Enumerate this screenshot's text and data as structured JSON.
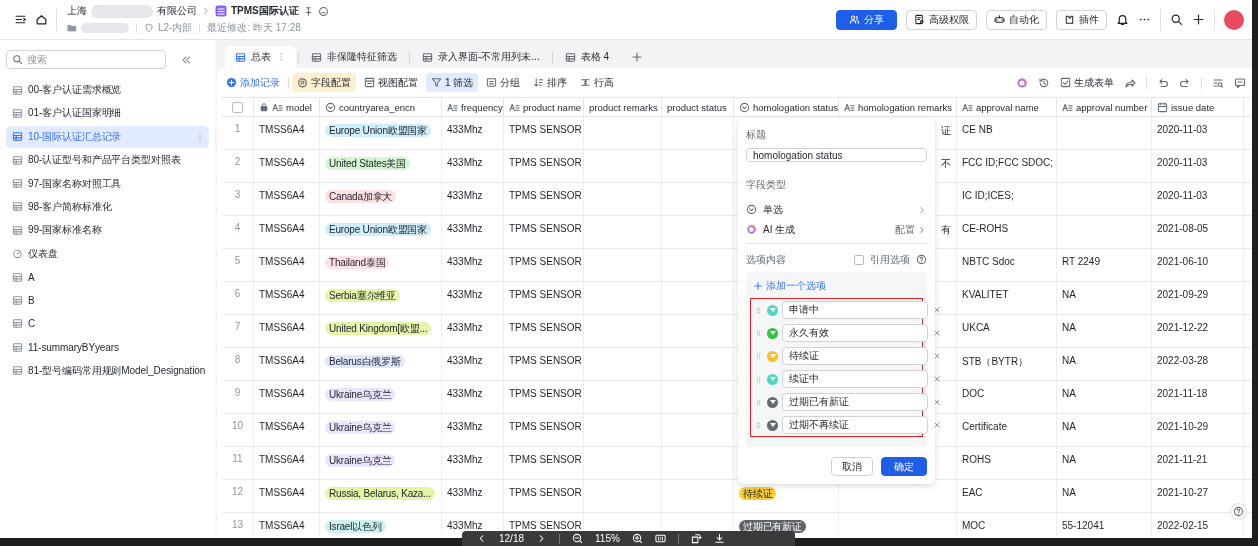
{
  "topbar": {
    "org_prefix": "上海",
    "org_suffix": "有限公司",
    "doc_title": "TPMS国际认证",
    "security": "L2-内部",
    "modified": "最近修改: 昨天 17:28",
    "buttons": [
      {
        "label": "分享",
        "kind": "share"
      },
      {
        "label": "高级权限",
        "kind": "permission"
      },
      {
        "label": "自动化",
        "kind": "automation"
      },
      {
        "label": "插件",
        "kind": "plugin"
      }
    ]
  },
  "sidebar": {
    "search_placeholder": "搜索",
    "items": [
      {
        "label": "00-客户认证需求概览",
        "kind": "table",
        "selected": false
      },
      {
        "label": "01-客户认证国家明细",
        "kind": "table",
        "selected": false
      },
      {
        "label": "10-国际认证汇总记录",
        "kind": "table",
        "selected": true
      },
      {
        "label": "80-认证型号和产品平台类型对照表",
        "kind": "table",
        "selected": false
      },
      {
        "label": "97-国家名称对照工具",
        "kind": "table",
        "selected": false
      },
      {
        "label": "98-客户简称标准化",
        "kind": "table",
        "selected": false
      },
      {
        "label": "99-国家标准名称",
        "kind": "table",
        "selected": false
      },
      {
        "label": "仪表盘",
        "kind": "dashboard",
        "selected": false
      },
      {
        "label": "A",
        "kind": "table",
        "selected": false
      },
      {
        "label": "B",
        "kind": "table",
        "selected": false
      },
      {
        "label": "C",
        "kind": "table",
        "selected": false
      },
      {
        "label": "11-summaryBYyears",
        "kind": "table",
        "selected": false
      },
      {
        "label": "81-型号编码常用规则Model_Designation",
        "kind": "table",
        "selected": false
      }
    ]
  },
  "view_tabs": [
    {
      "label": "总表",
      "selected": true
    },
    {
      "label": "非保隆特征筛选",
      "selected": false
    },
    {
      "label": "录入界面-不常用列未...",
      "selected": false
    },
    {
      "label": "表格 4",
      "selected": false
    }
  ],
  "toolbar": {
    "items": [
      {
        "label": "添加记录",
        "kind": "add",
        "active": false
      },
      {
        "label": "字段配置",
        "kind": "fields",
        "active": true
      },
      {
        "label": "视图配置",
        "kind": "view",
        "active": false
      },
      {
        "label": "1 筛选",
        "kind": "filter",
        "active": true
      },
      {
        "label": "分组",
        "kind": "group",
        "active": false
      },
      {
        "label": "排序",
        "kind": "sort",
        "active": false
      },
      {
        "label": "行高",
        "kind": "row-height",
        "active": false
      }
    ],
    "form_label": "生成表单"
  },
  "table": {
    "all_checked": false,
    "columns": [
      {
        "label": "model",
        "kind": "text",
        "locked": true
      },
      {
        "label": "countryarea_encn",
        "kind": "select",
        "locked": false
      },
      {
        "label": "frequency",
        "kind": "text",
        "locked": false
      },
      {
        "label": "product name",
        "kind": "text",
        "locked": false
      },
      {
        "label": "product remarks",
        "kind": "plain",
        "locked": false
      },
      {
        "label": "product status",
        "kind": "plain",
        "locked": false
      },
      {
        "label": "homologation status",
        "kind": "select",
        "locked": false
      },
      {
        "label": "homologation remarks",
        "kind": "text",
        "locked": false
      },
      {
        "label": "approval name",
        "kind": "text",
        "locked": false
      },
      {
        "label": "approval number",
        "kind": "text",
        "locked": false
      },
      {
        "label": "issue date",
        "kind": "date",
        "locked": false
      }
    ],
    "rows": [
      {
        "no": "1",
        "model": "TMSS6A4",
        "country": {
          "text": "Europe Union欧盟国家",
          "color": "#cdeefa"
        },
        "frequency": "433Mhz",
        "product_name": "TPMS SENSOR",
        "remarks": "证",
        "approval_name": "CE NB",
        "issue_date": "2020-11-03"
      },
      {
        "no": "2",
        "model": "TMSS6A4",
        "country": {
          "text": "United States美国",
          "color": "#d4f5d0"
        },
        "frequency": "433Mhz",
        "product_name": "TPMS SENSOR",
        "remarks": "不",
        "approval_name": "FCC ID;FCC SDOC;",
        "issue_date": "2020-11-03"
      },
      {
        "no": "3",
        "model": "TMSS6A4",
        "country": {
          "text": "Canada加拿大",
          "color": "#fde1e1"
        },
        "frequency": "433Mhz",
        "product_name": "TPMS SENSOR",
        "approval_name": "IC ID;ICES;",
        "issue_date": "2020-11-03"
      },
      {
        "no": "4",
        "model": "TMSS6A4",
        "country": {
          "text": "Europe Union欧盟国家",
          "color": "#cdeefa"
        },
        "frequency": "433Mhz",
        "product_name": "TPMS SENSOR",
        "remarks": "有",
        "approval_name": "CE-ROHS",
        "issue_date": "2021-08-05"
      },
      {
        "no": "5",
        "model": "TMSS6A4",
        "country": {
          "text": "Thailand泰国",
          "color": "#fde0ec"
        },
        "frequency": "433Mhz",
        "product_name": "TPMS SENSOR",
        "approval_name": "NBTC Sdoc",
        "approval_number": "RT 2249",
        "issue_date": "2021-06-10"
      },
      {
        "no": "6",
        "model": "TMSS6A4",
        "country": {
          "text": "Serbia塞尔维亚",
          "color": "#e4f5a9"
        },
        "frequency": "433Mhz",
        "product_name": "TPMS SENSOR",
        "approval_name": "KVALITET",
        "approval_number": "NA",
        "issue_date": "2021-09-29"
      },
      {
        "no": "7",
        "model": "TMSS6A4",
        "country": {
          "text": "United Kingdom[欧盟...",
          "color": "#e4f5a9"
        },
        "frequency": "433Mhz",
        "product_name": "TPMS SENSOR",
        "approval_name": "UKCA",
        "approval_number": "NA",
        "issue_date": "2021-12-22"
      },
      {
        "no": "8",
        "model": "TMSS6A4",
        "country": {
          "text": "Belarus白俄罗斯",
          "color": "#dfe7fc"
        },
        "frequency": "433Mhz",
        "product_name": "TPMS SENSOR",
        "approval_name": "STB（BYTR）",
        "approval_number": "NA",
        "issue_date": "2022-03-28"
      },
      {
        "no": "9",
        "model": "TMSS6A4",
        "country": {
          "text": "Ukraine乌克兰",
          "color": "#ece3fc"
        },
        "frequency": "433Mhz",
        "product_name": "TPMS SENSOR",
        "approval_name": "DOC",
        "approval_number": "NA",
        "issue_date": "2021-11-18"
      },
      {
        "no": "10",
        "model": "TMSS6A4",
        "country": {
          "text": "Ukraine乌克兰",
          "color": "#ece3fc"
        },
        "frequency": "433Mhz",
        "product_name": "TPMS SENSOR",
        "approval_name": "Certificate",
        "approval_number": "NA",
        "issue_date": "2021-10-29"
      },
      {
        "no": "11",
        "model": "TMSS6A4",
        "country": {
          "text": "Ukraine乌克兰",
          "color": "#ece3fc"
        },
        "frequency": "433Mhz",
        "product_name": "TPMS SENSOR",
        "approval_name": "ROHS",
        "approval_number": "NA",
        "issue_date": "2021-11-21"
      },
      {
        "no": "12",
        "model": "TMSS6A4",
        "country": {
          "text": "Russia, Belarus, Kaza...",
          "color": "#e4f5a9"
        },
        "frequency": "433Mhz",
        "product_name": "TPMS SENSOR",
        "status": {
          "text": "待续证",
          "color": "#fbcf33"
        },
        "approval_name": "EAC",
        "approval_number": "NA",
        "issue_date": "2021-10-27"
      },
      {
        "no": "13",
        "model": "TMSS6A4",
        "country": {
          "text": "Israel以色列",
          "color": "#cbf2ee"
        },
        "frequency": "433Mhz",
        "product_name": "TPMS SENSOR",
        "status": {
          "text": "过期已有新证",
          "color": "#5f6368"
        },
        "approval_name": "MOC",
        "approval_number": "55-12041",
        "issue_date": "2022-02-15"
      }
    ]
  },
  "popup": {
    "title_label": "标题",
    "title_value": "homologation status",
    "type_label": "字段类型",
    "type_value": "单选",
    "ai_label": "AI 生成",
    "ai_action": "配置",
    "options_label": "选项内容",
    "ref_label": "引用选项",
    "ref_checked": false,
    "add_label": "添加一个选项",
    "options_highlighted": true,
    "options": [
      {
        "text": "申请中",
        "color": "#4fd6c4"
      },
      {
        "text": "永久有效",
        "color": "#34c240"
      },
      {
        "text": "待续证",
        "color": "#fbbf24"
      },
      {
        "text": "续证中",
        "color": "#4fd6c4"
      },
      {
        "text": "过期已有新证",
        "color": "#646a73"
      },
      {
        "text": "过期不再续证",
        "color": "#646a73"
      }
    ],
    "cancel": "取消",
    "ok": "确定"
  },
  "viewer": {
    "page": "12/18",
    "zoom": "115%"
  }
}
